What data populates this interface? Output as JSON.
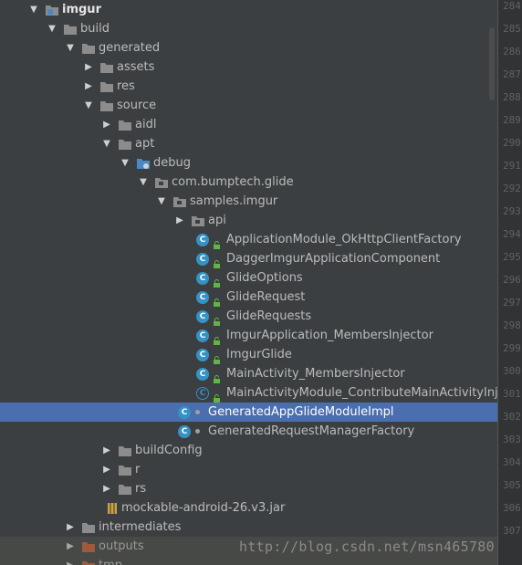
{
  "tree": {
    "rows": [
      {
        "label": "imgur",
        "kind": "module",
        "arrow": "open",
        "bold": true
      },
      {
        "label": "build",
        "kind": "folder",
        "arrow": "open"
      },
      {
        "label": "generated",
        "kind": "folder",
        "arrow": "open"
      },
      {
        "label": "assets",
        "kind": "folder",
        "arrow": "closed"
      },
      {
        "label": "res",
        "kind": "folder",
        "arrow": "closed"
      },
      {
        "label": "source",
        "kind": "folder",
        "arrow": "open"
      },
      {
        "label": "aidl",
        "kind": "folder",
        "arrow": "closed"
      },
      {
        "label": "apt",
        "kind": "folder",
        "arrow": "open"
      },
      {
        "label": "debug",
        "kind": "src-folder",
        "arrow": "open"
      },
      {
        "label": "com.bumptech.glide",
        "kind": "package",
        "arrow": "open"
      },
      {
        "label": "samples.imgur",
        "kind": "package",
        "arrow": "open"
      },
      {
        "label": "api",
        "kind": "package",
        "arrow": "closed"
      },
      {
        "label": "ApplicationModule_OkHttpClientFactory",
        "kind": "class"
      },
      {
        "label": "DaggerImgurApplicationComponent",
        "kind": "class"
      },
      {
        "label": "GlideOptions",
        "kind": "class"
      },
      {
        "label": "GlideRequest",
        "kind": "class"
      },
      {
        "label": "GlideRequests",
        "kind": "class"
      },
      {
        "label": "ImgurApplication_MembersInjector",
        "kind": "class"
      },
      {
        "label": "ImgurGlide",
        "kind": "class"
      },
      {
        "label": "MainActivity_MembersInjector",
        "kind": "class"
      },
      {
        "label": "MainActivityModule_ContributeMainActivityInjector",
        "kind": "abstract-class"
      },
      {
        "label": "GeneratedAppGlideModuleImpl",
        "kind": "class-private",
        "selected": true
      },
      {
        "label": "GeneratedRequestManagerFactory",
        "kind": "class-private"
      },
      {
        "label": "buildConfig",
        "kind": "folder",
        "arrow": "closed"
      },
      {
        "label": "r",
        "kind": "folder",
        "arrow": "closed"
      },
      {
        "label": "rs",
        "kind": "folder",
        "arrow": "closed"
      },
      {
        "label": "mockable-android-26.v3.jar",
        "kind": "jar"
      },
      {
        "label": "intermediates",
        "kind": "folder",
        "arrow": "closed"
      },
      {
        "label": "outputs",
        "kind": "orange-folder",
        "arrow": "closed"
      },
      {
        "label": "tmp",
        "kind": "orange-folder",
        "arrow": "closed"
      }
    ]
  },
  "gutter": {
    "line_numbers": [
      "284",
      "285",
      "286",
      "287",
      "288",
      "289",
      "290",
      "291",
      "292",
      "293",
      "294",
      "295",
      "296",
      "297",
      "298",
      "299",
      "300",
      "301",
      "302",
      "303",
      "304",
      "305",
      "306",
      "307"
    ]
  },
  "watermark": "http://blog.csdn.net/msn465780",
  "colors": {
    "background": "#3c3f41",
    "selection": "#4b6eaf",
    "class_icon": "#3592c4",
    "folder": "#8c8c8c",
    "orange_folder": "#c75830",
    "lock": "#62b543"
  }
}
